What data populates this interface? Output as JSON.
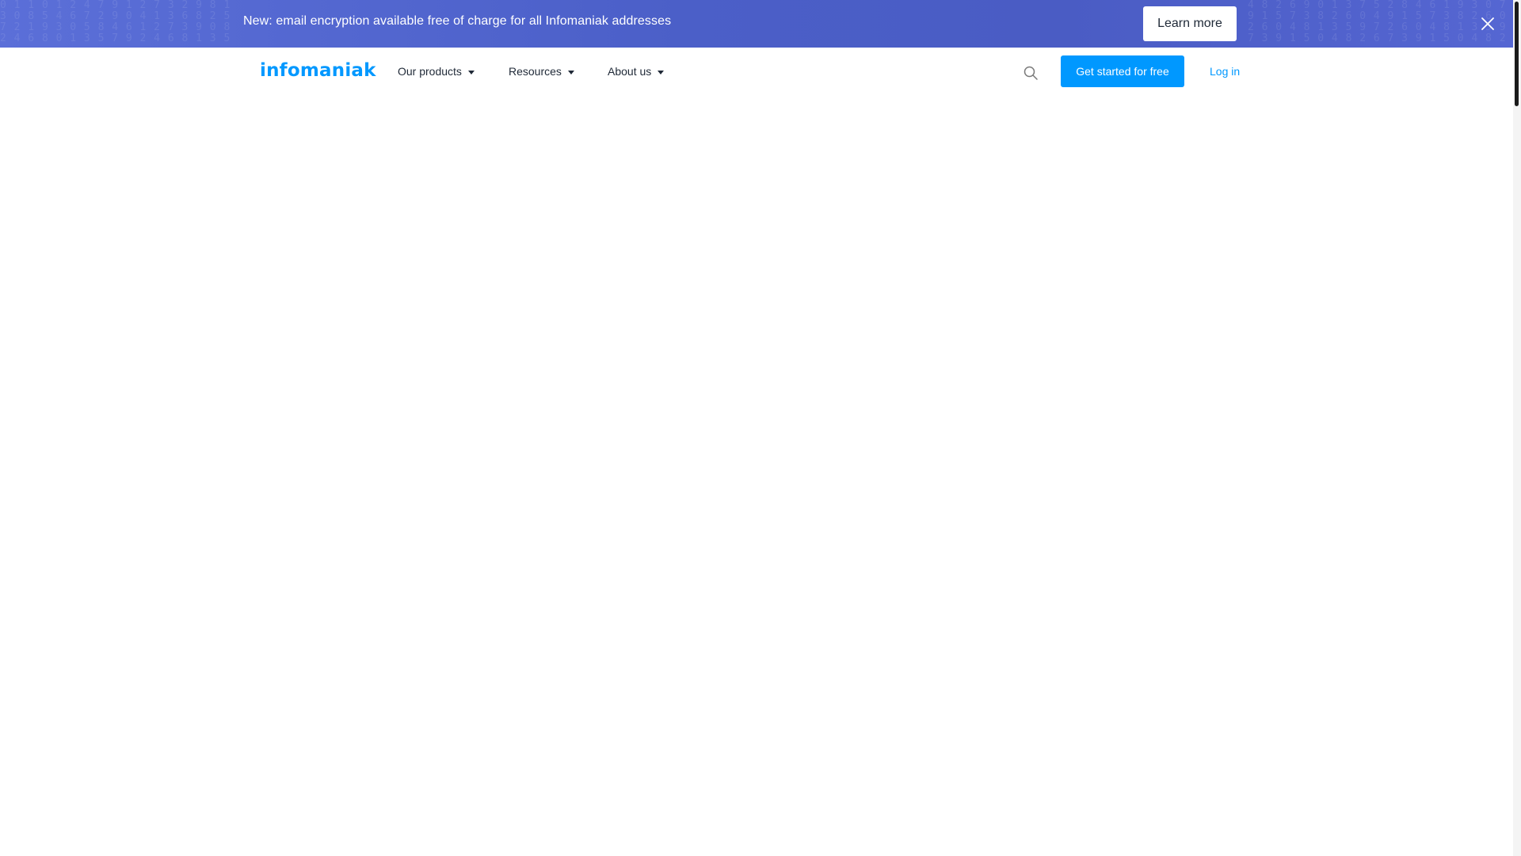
{
  "banner": {
    "message": "New: email encryption available free of charge for all Infomaniak addresses",
    "cta_label": "Learn more",
    "close_icon": "close-icon",
    "gradient_colors": [
      "#5b6fd8",
      "#4b5fc8",
      "#4a5cc4",
      "#5566d2"
    ]
  },
  "header": {
    "logo_text": "infomaniak",
    "nav_items": [
      {
        "label": "Our products"
      },
      {
        "label": "Resources"
      },
      {
        "label": "About us"
      }
    ],
    "search_icon": "search-icon",
    "cta_label": "Get started for free",
    "login_label": "Log in"
  },
  "colors": {
    "brand": "#0098ff",
    "text": "#1f2937",
    "banner_text": "#ffffff"
  }
}
